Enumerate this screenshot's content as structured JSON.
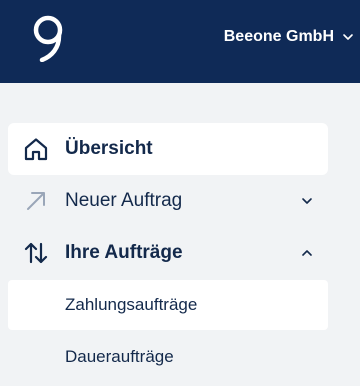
{
  "header": {
    "company_name": "Beeone GmbH",
    "logo_icon": "brand-logo",
    "dropdown_icon": "chevron-down-icon",
    "background": "#0f2a57"
  },
  "nav": {
    "items": [
      {
        "label": "Übersicht",
        "icon": "home-icon",
        "active": true,
        "bold": true
      },
      {
        "label": "Neuer Auftrag",
        "icon": "arrow-up-right-icon",
        "expanded": false
      },
      {
        "label": "Ihre Aufträge",
        "icon": "arrows-up-down-icon",
        "expanded": true,
        "bold": true
      }
    ],
    "sub_items": [
      {
        "label": "Zahlungsaufträge",
        "active": true
      },
      {
        "label": "Daueraufträge",
        "active": false
      }
    ]
  }
}
